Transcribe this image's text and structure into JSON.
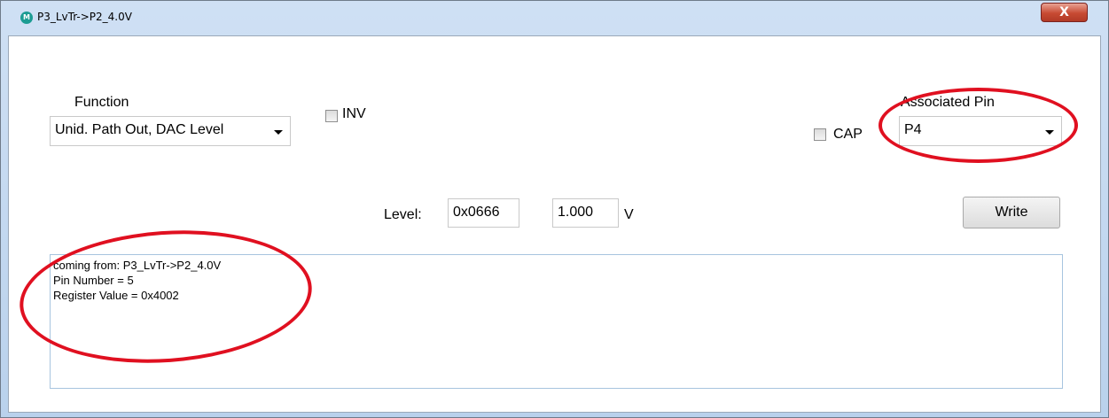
{
  "window": {
    "title": "P3_LvTr->P2_4.0V",
    "icon_text": "M",
    "close_glyph": "X"
  },
  "function": {
    "label": "Function",
    "selected": "Unid. Path Out, DAC Level"
  },
  "inv": {
    "label": "INV",
    "checked": false
  },
  "cap": {
    "label": "CAP",
    "checked": false
  },
  "associated_pin": {
    "label": "Associated Pin",
    "selected": "P4"
  },
  "level": {
    "label": "Level:",
    "hex_value": "0x0666",
    "volt_value": "1.000",
    "unit": "V"
  },
  "write_button": {
    "label": "Write"
  },
  "log": {
    "lines": [
      "coming from: P3_LvTr->P2_4.0V",
      "Pin Number = 5",
      "Register Value = 0x4002"
    ]
  },
  "annotation_color": "#e01020"
}
